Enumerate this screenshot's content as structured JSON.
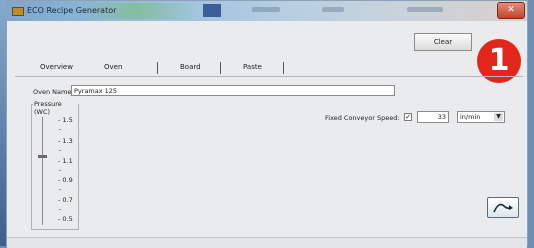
{
  "window": {
    "title": "ECO Recipe Generator",
    "close_glyph": "✕"
  },
  "toolbar": {
    "clear_label": "Clear"
  },
  "badge": {
    "number": "1",
    "color": "#e3261b"
  },
  "tabs": [
    {
      "label": "Overview"
    },
    {
      "label": "Oven"
    },
    {
      "label": "Board"
    },
    {
      "label": "Paste"
    }
  ],
  "oven": {
    "name_label": "Oven Name:",
    "name_value": "Pyramax 125"
  },
  "pressure": {
    "title": "Pressure (WC)",
    "ticks": [
      "1.5",
      "1.3",
      "1.1",
      "0.9",
      "0.7",
      "0.5"
    ],
    "selected": "1.1"
  },
  "conveyor": {
    "label": "Fixed Conveyor Speed:",
    "checked_glyph": "✓",
    "value": "33",
    "unit": "in/min",
    "dropdown_icon": "chevron-down-icon"
  },
  "action": {
    "icon": "curve-arrow-icon"
  }
}
